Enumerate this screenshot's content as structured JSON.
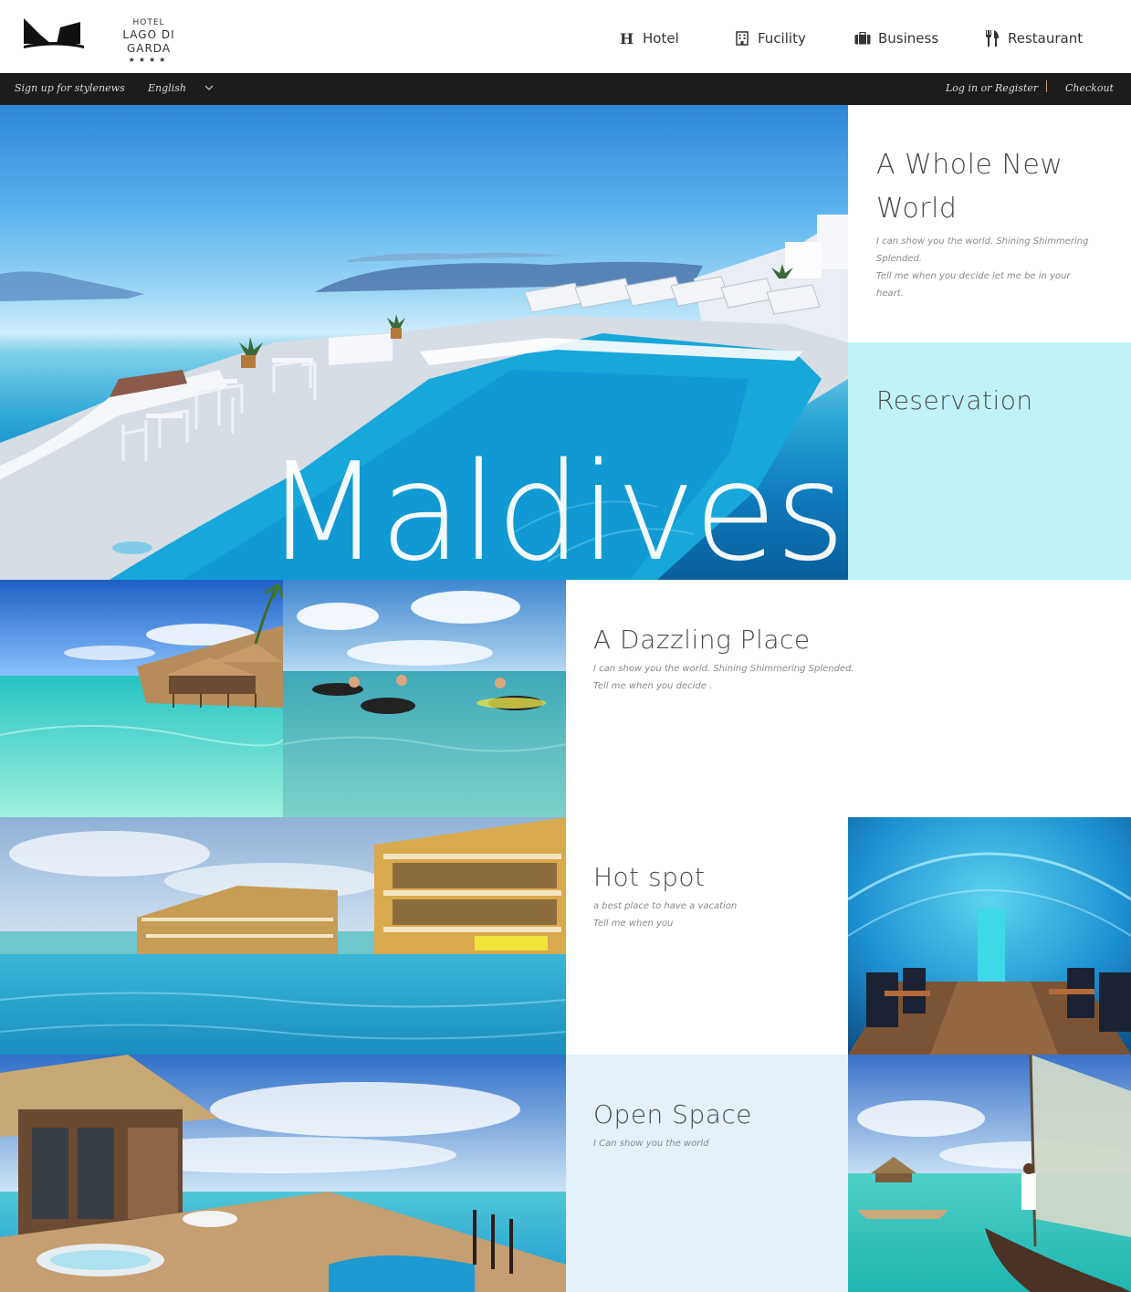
{
  "logo": {
    "small": "HOTEL",
    "name": "LAGO DI GARDA",
    "stars": "★★★★"
  },
  "nav": {
    "items": [
      {
        "label": "Hotel",
        "icon": "hotel-h-icon"
      },
      {
        "label": "Fucility",
        "icon": "building-icon"
      },
      {
        "label": "Business",
        "icon": "briefcase-icon"
      },
      {
        "label": "Restaurant",
        "icon": "fork-knife-icon"
      }
    ]
  },
  "topbar": {
    "signup": "Sign up for stylenews",
    "language": "English",
    "login": "Log in or Register",
    "checkout": "Checkout"
  },
  "hero": {
    "title": "Maldives"
  },
  "panels": {
    "whole": {
      "title_line1": "A Whole New",
      "title_line2": "World",
      "text_line1": "I can show you the world. Shining Shimmering",
      "text_line2": "Splended.",
      "text_line3": "Tell me when you decide let me be in your",
      "text_line4": "heart."
    },
    "reservation": {
      "title": "Reservation"
    },
    "dazzling": {
      "title": "A Dazzling Place",
      "text_line1": "I can show you the world. Shining Shimmering Splended.",
      "text_line2": "Tell me when you decide ."
    },
    "hotspot": {
      "title": "Hot spot",
      "text_line1": "a best place to have a vacation",
      "text_line2": "Tell me when you"
    },
    "openspace": {
      "title": "Open Space",
      "text_line1": "I Can show you the world"
    }
  },
  "colors": {
    "topbar_bg": "#1c1c1c",
    "reservation_bg": "#bff3f8",
    "openspace_bg": "#e4f0fa",
    "separator": "#c8a07a"
  }
}
